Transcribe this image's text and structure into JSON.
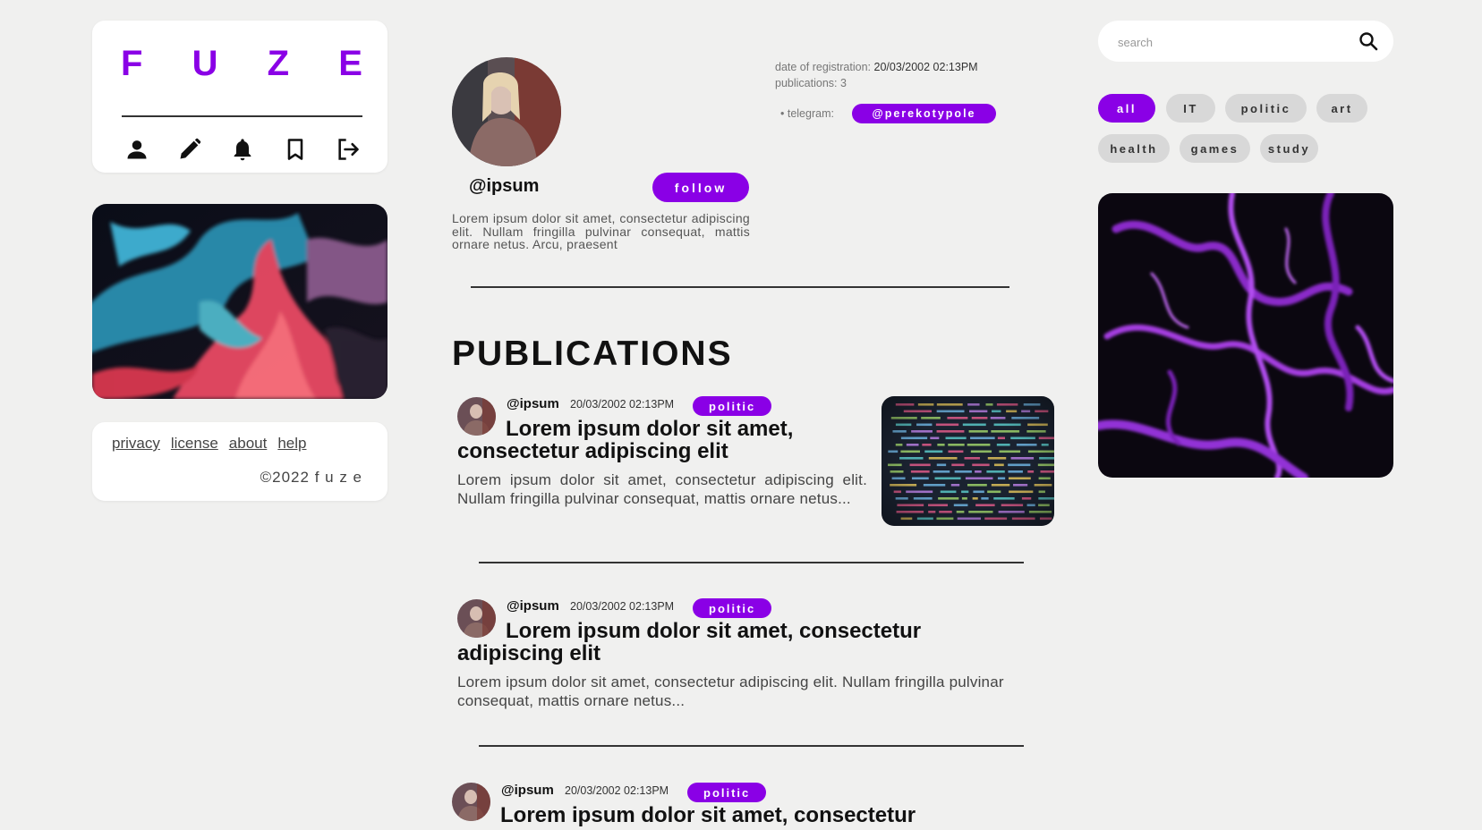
{
  "brand": {
    "letters": [
      "F",
      "U",
      "Z",
      "E"
    ],
    "color": "#8a00e6"
  },
  "nav_icons": [
    "user-icon",
    "pencil-icon",
    "bell-icon",
    "bookmark-icon",
    "logout-icon"
  ],
  "footer": {
    "links": [
      "privacy",
      "license",
      "about",
      "help"
    ],
    "copyright": "©2022 f u z e"
  },
  "profile": {
    "username": "@ipsum",
    "follow_label": "follow",
    "bio": "Lorem ipsum dolor sit amet, consectetur adipiscing elit. Nullam fringilla pulvinar consequat, mattis ornare netus. Arcu, praesent",
    "registration_label": "date of registration:",
    "registration_value": "20/03/2002 02:13PM",
    "publications_label": "publications:",
    "publications_value": "3",
    "telegram_label": "• telegram:",
    "telegram_value": "@perekotypole"
  },
  "publications_heading": "PUBLICATIONS",
  "posts": [
    {
      "author": "@ipsum",
      "date": "20/03/2002 02:13PM",
      "tag": "politic",
      "title": "Lorem ipsum dolor sit amet, consectetur adipiscing elit",
      "excerpt": "Lorem ipsum dolor sit amet, consectetur adipiscing elit. Nullam fringilla pulvinar consequat, mattis ornare netus..."
    },
    {
      "author": "@ipsum",
      "date": "20/03/2002 02:13PM",
      "tag": "politic",
      "title": "Lorem ipsum dolor sit amet, consectetur adipiscing elit",
      "excerpt": "Lorem ipsum dolor sit amet, consectetur adipiscing elit. Nullam fringilla pulvinar consequat, mattis ornare netus..."
    },
    {
      "author": "@ipsum",
      "date": "20/03/2002 02:13PM",
      "tag": "politic",
      "title": "Lorem ipsum dolor sit amet, consectetur"
    }
  ],
  "search": {
    "placeholder": "search"
  },
  "categories": [
    "all",
    "IT",
    "politic",
    "art",
    "health",
    "games",
    "study"
  ],
  "active_category": "all",
  "colors": {
    "accent": "#8a00e6",
    "background": "#f0f0ef",
    "chip": "#d8d8d8"
  }
}
